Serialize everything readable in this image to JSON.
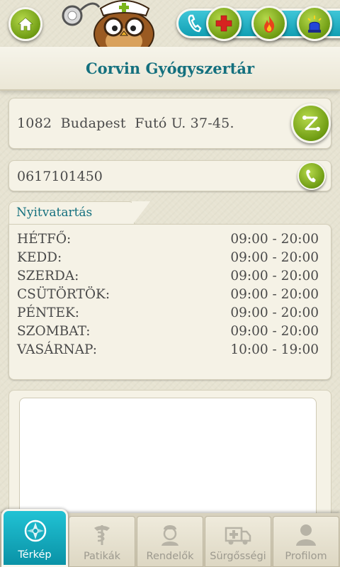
{
  "header": {
    "pharmacy_name": "Corvin Gyógyszertár"
  },
  "topbar": {
    "icons": [
      "home-icon",
      "owl-doctor-mascot",
      "phone-icon",
      "red-cross-icon",
      "fire-icon",
      "police-siren-icon"
    ],
    "colors": {
      "button_green": "#7aa51a",
      "strip_teal": "#2bb6c8"
    }
  },
  "address": {
    "text": "1082  Budapest  Futó U. 37-45."
  },
  "phone": {
    "number": "0617101450"
  },
  "hours": {
    "title": "Nyitvatartás",
    "rows": [
      {
        "day": "HÉTFŐ:",
        "time": "09:00 - 20:00"
      },
      {
        "day": "KEDD:",
        "time": "09:00 - 20:00"
      },
      {
        "day": "SZERDA:",
        "time": "09:00 - 20:00"
      },
      {
        "day": "CSÜTÖRTÖK:",
        "time": "09:00 - 20:00"
      },
      {
        "day": "PÉNTEK:",
        "time": "09:00 - 20:00"
      },
      {
        "day": "SZOMBAT:",
        "time": "09:00 - 20:00"
      },
      {
        "day": "VASÁRNAP:",
        "time": "10:00 - 19:00"
      }
    ]
  },
  "nav": {
    "items": [
      {
        "label": "Térkép",
        "icon": "compass-icon",
        "active": true
      },
      {
        "label": "Patikák",
        "icon": "caduceus-icon",
        "active": false
      },
      {
        "label": "Rendelők",
        "icon": "nurse-icon",
        "active": false
      },
      {
        "label": "Sürgősségi",
        "icon": "ambulance-icon",
        "active": false
      },
      {
        "label": "Profilom",
        "icon": "user-icon",
        "active": false
      }
    ],
    "colors": {
      "active_teal": "#12a3b6",
      "inactive_text": "#9d9a8f"
    }
  },
  "colors": {
    "title_teal": "#14707e",
    "background": "#e7e3d2"
  }
}
